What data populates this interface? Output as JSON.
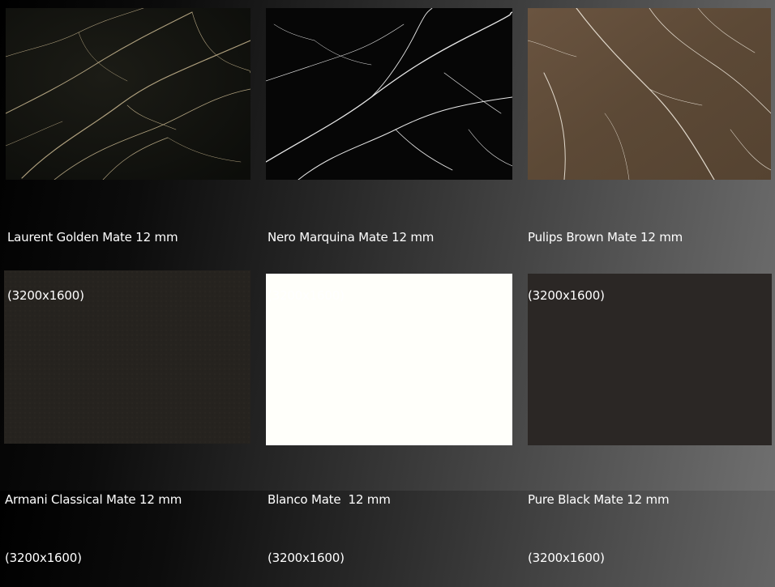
{
  "products": [
    {
      "name": "Laurent Golden Mate 12 mm",
      "size": "(3200x1600)",
      "swatch": "#13140f"
    },
    {
      "name": "Nero Marquina Mate 12 mm",
      "size": "(3200x1600)",
      "swatch": "#050505"
    },
    {
      "name": "Pulips Brown Mate 12 mm",
      "size": "(3200x1600)",
      "swatch": "#5e4a38"
    },
    {
      "name": "Armani Classical Mate 12 mm",
      "size": "(3200x1600)",
      "swatch": "#26231f"
    },
    {
      "name": "Blanco Mate  12 mm",
      "size": "(3200x1600)",
      "swatch": "#fffffa"
    },
    {
      "name": "Pure Black Mate 12 mm",
      "size": "(3200x1600)",
      "swatch": "#2b2725"
    }
  ]
}
